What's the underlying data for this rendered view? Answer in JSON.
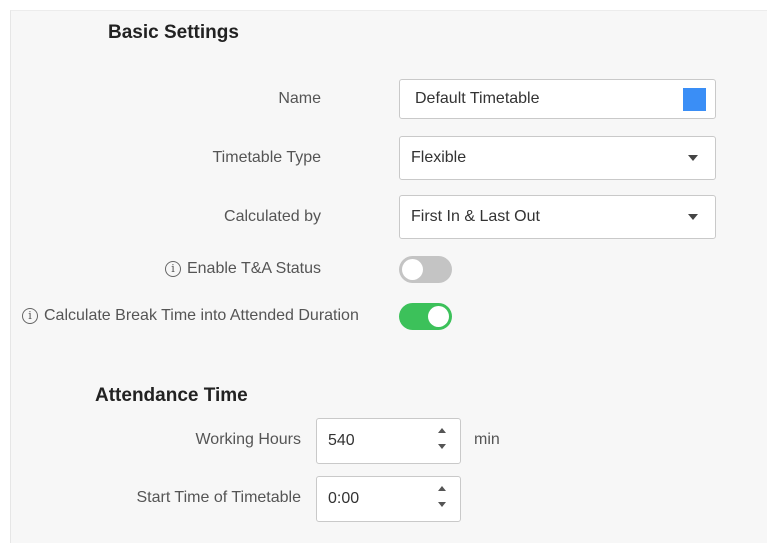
{
  "basic_settings": {
    "title": "Basic Settings",
    "name": {
      "label": "Name",
      "value": "Default Timetable",
      "color": "#3a8ef6"
    },
    "timetable_type": {
      "label": "Timetable Type",
      "value": "Flexible"
    },
    "calculated_by": {
      "label": "Calculated by",
      "value": "First In & Last Out"
    },
    "enable_ta_status": {
      "label": "Enable T&A Status",
      "on": false
    },
    "calculate_break_time": {
      "label": "Calculate Break Time into Attended Duration",
      "on": true
    }
  },
  "attendance_time": {
    "title": "Attendance Time",
    "working_hours": {
      "label": "Working Hours",
      "value": "540",
      "unit": "min"
    },
    "start_time": {
      "label": "Start Time of Timetable",
      "value": "0:00"
    }
  },
  "icons": {
    "info": "info-icon",
    "dropdown": "chevron-down-icon",
    "stepper": "stepper-arrows-icon"
  },
  "colors": {
    "toggle_on": "#3cc15a",
    "toggle_off": "#c4c4c4",
    "accent": "#3a8ef6"
  }
}
